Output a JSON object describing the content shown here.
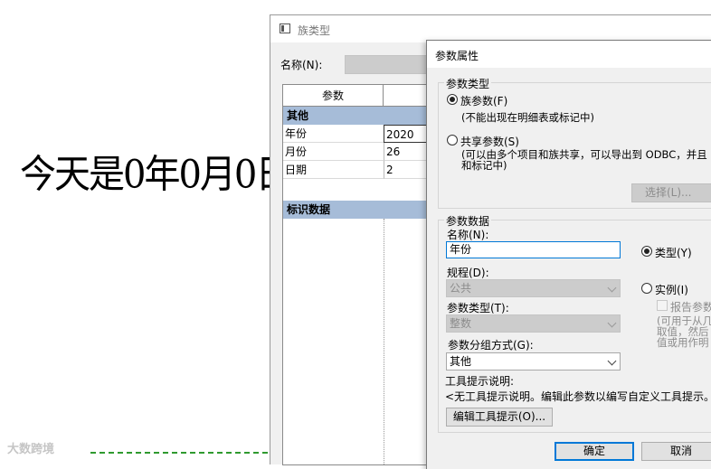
{
  "canvas": {
    "date_text": "今天是0年0月0日",
    "watermark": "大数跨境"
  },
  "family_types": {
    "title": "族类型",
    "name_label": "名称(N):",
    "table": {
      "header_param": "参数",
      "groups": [
        "其他",
        "标识数据"
      ],
      "rows": [
        {
          "name": "年份",
          "value": "2020"
        },
        {
          "name": "月份",
          "value": "26"
        },
        {
          "name": "日期",
          "value": "2"
        }
      ]
    }
  },
  "param_dialog": {
    "title": "参数属性",
    "param_type_group": "参数类型",
    "family_param_label": "族参数(F)",
    "family_param_note": "(不能出现在明细表或标记中)",
    "shared_param_label": "共享参数(S)",
    "shared_param_note_1": "(可以由多个项目和族共享，可以导出到 ODBC，并且",
    "shared_param_note_2": "和标记中)",
    "select_button": "选择(L)...",
    "param_data_group": "参数数据",
    "name_label": "名称(N):",
    "name_value": "年份",
    "type_label": "类型(Y)",
    "discipline_label": "规程(D):",
    "discipline_value": "公共",
    "instance_label": "实例(I)",
    "param_type_label": "参数类型(T):",
    "param_type_value": "整数",
    "report_label": "报告参数",
    "report_note_1": "(可用于从几",
    "report_note_2": "取值，然后",
    "report_note_3": "值或用作明",
    "group_by_label": "参数分组方式(G):",
    "group_by_value": "其他",
    "tooltip_label": "工具提示说明:",
    "tooltip_text": "<无工具提示说明。编辑此参数以编写自定义工具提示。",
    "edit_tooltip_button": "编辑工具提示(O)...",
    "ok_button": "确定",
    "cancel_button": "取消"
  }
}
